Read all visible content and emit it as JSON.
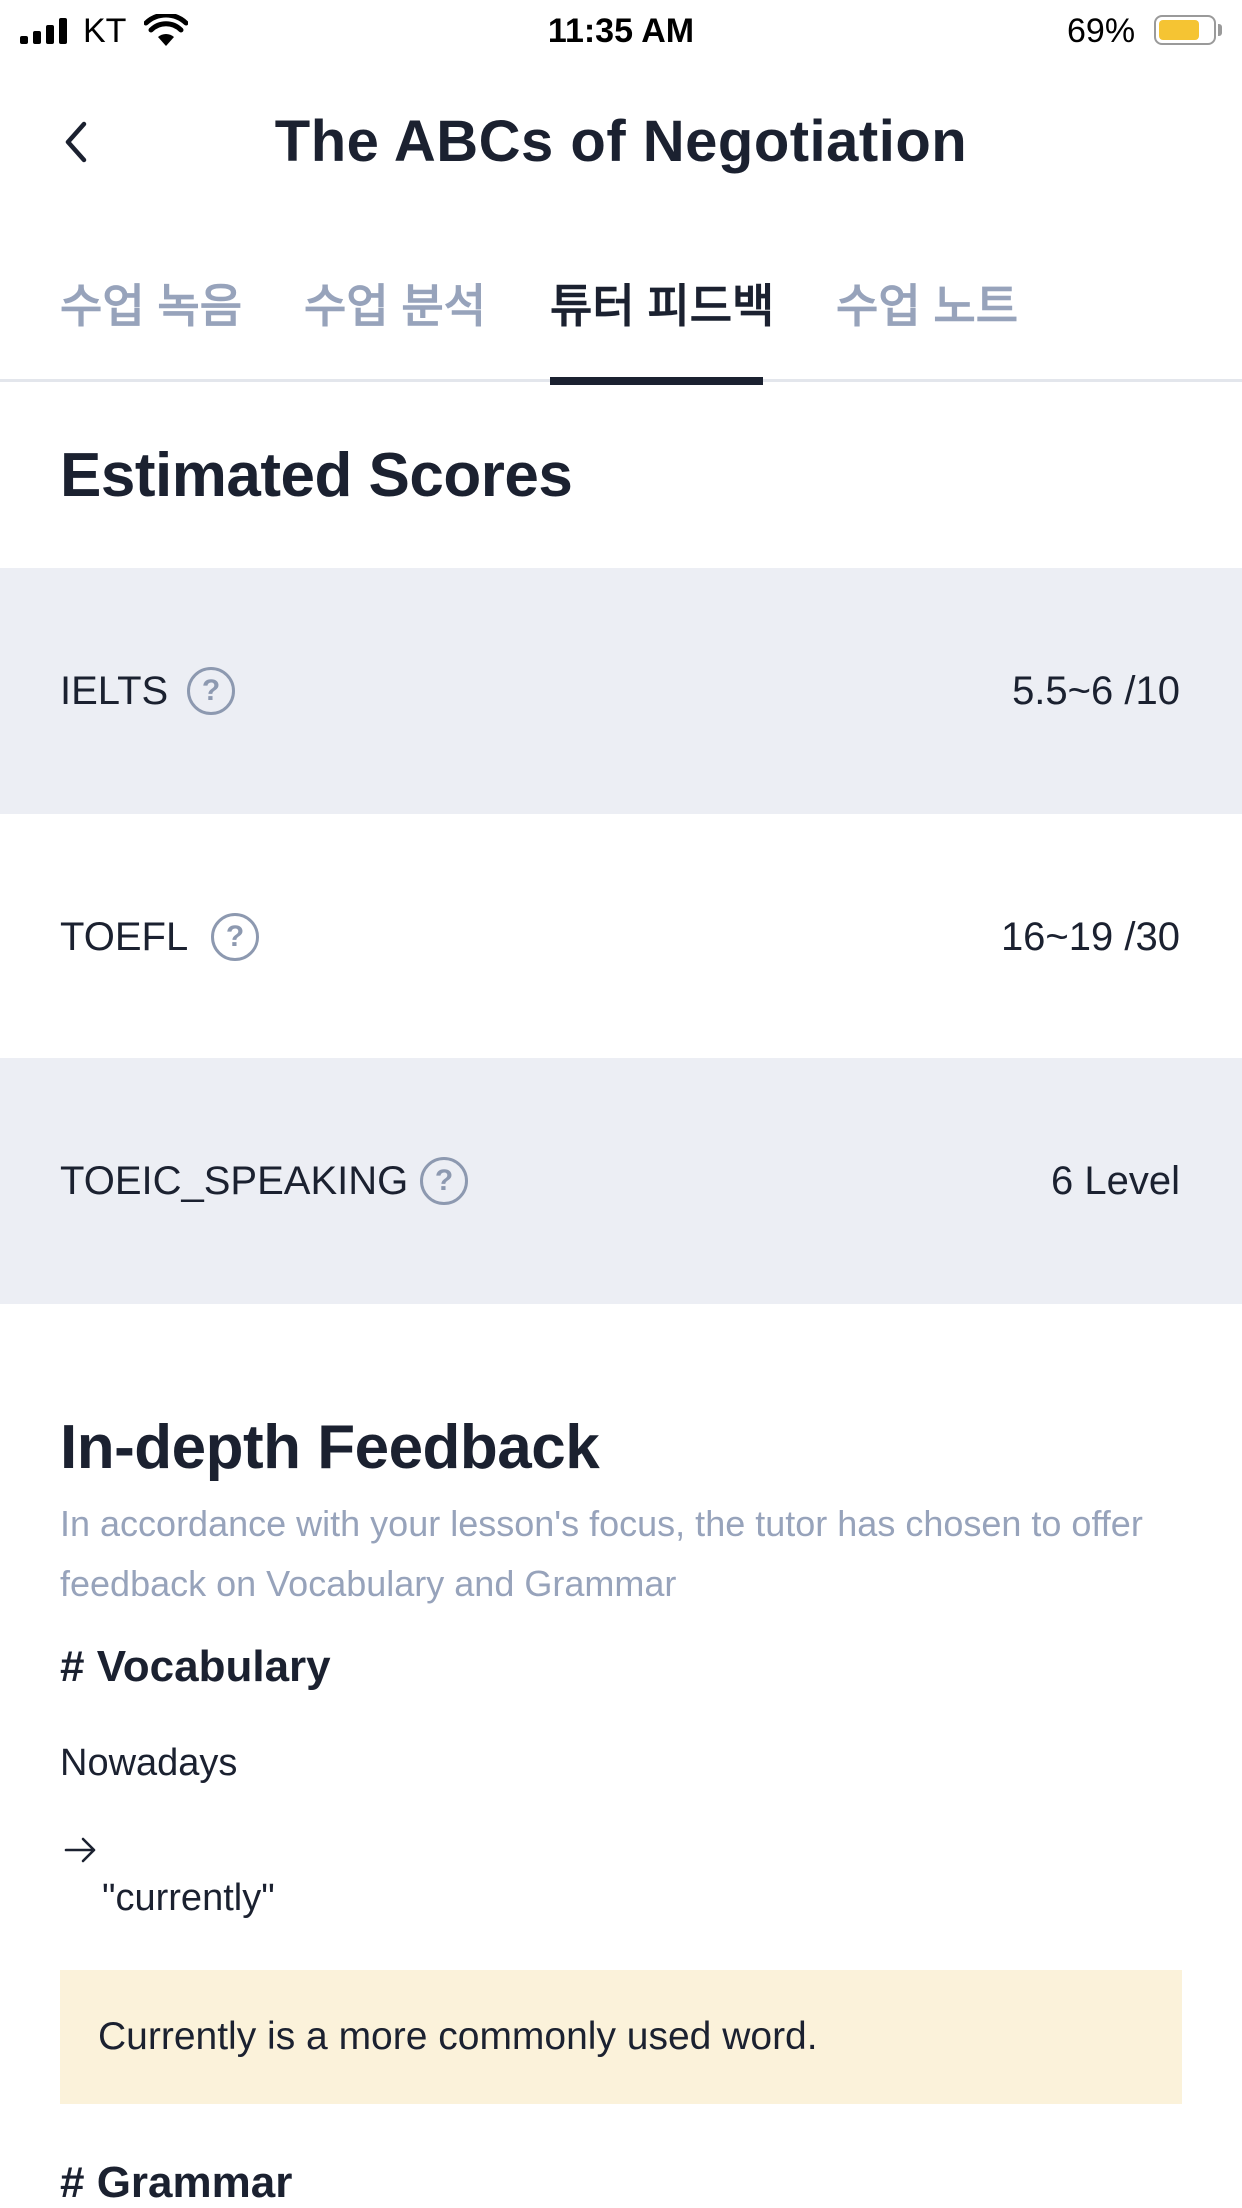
{
  "status_bar": {
    "carrier": "KT",
    "time": "11:35 AM",
    "battery_percent": "69%",
    "battery_level": 0.69,
    "battery_color": "#f5c433"
  },
  "header": {
    "back_icon": "chevron-left-icon",
    "title": "The ABCs of Negotiation"
  },
  "tabs": [
    {
      "label": "수업 녹음",
      "active": false
    },
    {
      "label": "수업 분석",
      "active": false
    },
    {
      "label": "튜터 피드백",
      "active": true
    },
    {
      "label": "수업 노트",
      "active": false
    }
  ],
  "scores": {
    "title": "Estimated Scores",
    "help_icon": "question-circle-icon",
    "rows": [
      {
        "label": "IELTS",
        "value": "5.5~6 /10"
      },
      {
        "label": "TOEFL",
        "value": "16~19 /30"
      },
      {
        "label": "TOEIC_SPEAKING",
        "value": "6  Level"
      }
    ]
  },
  "feedback": {
    "title": "In-depth Feedback",
    "description": "In accordance with your lesson's focus, the tutor has chosen to offer feedback on Vocabulary and Grammar",
    "vocabulary_heading": "# Vocabulary",
    "original_word": "Nowadays",
    "arrow_icon": "arrow-right-icon",
    "correction": "\"currently\"",
    "note": "Currently is a more commonly used word.",
    "grammar_heading": "# Grammar"
  },
  "colors": {
    "text": "#1b2130",
    "muted": "#97a3bb",
    "row_shade": "#eceef4",
    "note_bg": "#fbf2da"
  }
}
